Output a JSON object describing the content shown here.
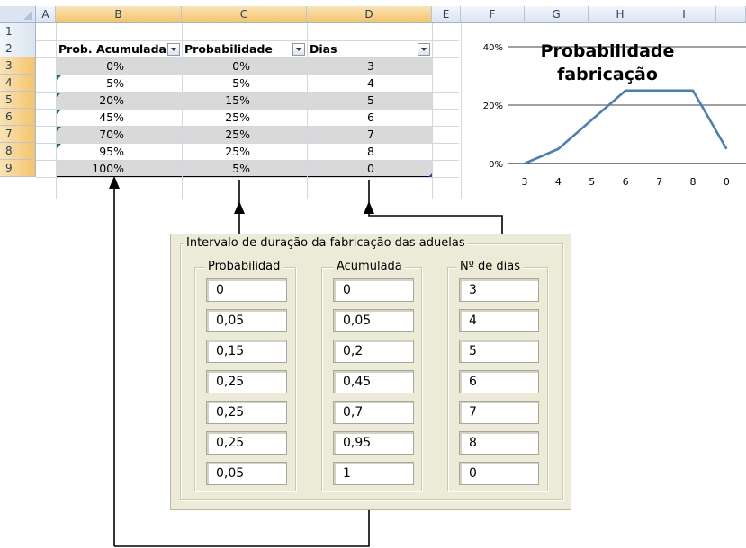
{
  "sheet": {
    "columns": [
      "A",
      "B",
      "C",
      "D",
      "E",
      "F",
      "G",
      "H",
      "I"
    ],
    "rows": [
      "1",
      "2",
      "3",
      "4",
      "5",
      "6",
      "7",
      "8",
      "9"
    ],
    "headers": {
      "prob_acumulada": "Prob. Acumulada",
      "probabilidade": "Probabilidade",
      "dias": "Dias"
    },
    "data": [
      {
        "acum": "0%",
        "prob": "0%",
        "dias": "3"
      },
      {
        "acum": "5%",
        "prob": "5%",
        "dias": "4"
      },
      {
        "acum": "20%",
        "prob": "15%",
        "dias": "5"
      },
      {
        "acum": "45%",
        "prob": "25%",
        "dias": "6"
      },
      {
        "acum": "70%",
        "prob": "25%",
        "dias": "7"
      },
      {
        "acum": "95%",
        "prob": "25%",
        "dias": "8"
      },
      {
        "acum": "100%",
        "prob": "5%",
        "dias": "0"
      }
    ],
    "band_color": "#d9d9d9",
    "selected_columns": [
      "B",
      "C",
      "D"
    ]
  },
  "chart_data": {
    "type": "line",
    "title": "Probabilidade fabricação",
    "title_lines": [
      "Probabilidade",
      "fabricação"
    ],
    "categories": [
      "3",
      "4",
      "5",
      "6",
      "7",
      "8",
      "0"
    ],
    "series": [
      {
        "values": [
          0,
          5,
          15,
          25,
          25,
          25,
          5
        ],
        "color": "#4a7ebb"
      }
    ],
    "y_ticks": [
      "0%",
      "20%",
      "40%"
    ],
    "ylim": [
      0,
      40
    ],
    "grid": true
  },
  "form": {
    "title": "Intervalo de duração da fabricação das aduelas",
    "groups": [
      {
        "label": "Probabilidad",
        "values": [
          "0",
          "0,05",
          "0,15",
          "0,25",
          "0,25",
          "0,25",
          "0,05"
        ]
      },
      {
        "label": "Acumulada",
        "values": [
          "0",
          "0,05",
          "0,2",
          "0,45",
          "0,7",
          "0,95",
          "1"
        ]
      },
      {
        "label": "Nº de dias",
        "values": [
          "3",
          "4",
          "5",
          "6",
          "7",
          "8",
          "0"
        ]
      }
    ],
    "background": "#ecebd8"
  }
}
